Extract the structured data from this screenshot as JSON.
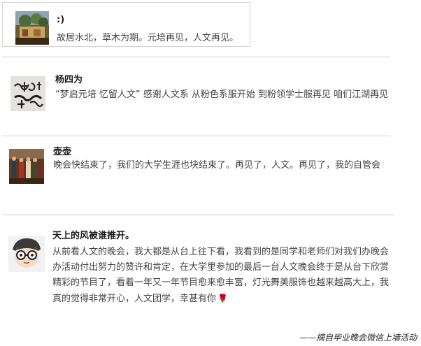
{
  "comments": [
    {
      "name": ":)",
      "text": "故居水北，草木为期。元培再见，人文再见。",
      "avatar": "landscape-avatar"
    },
    {
      "name": "杨四为",
      "text": "“梦启元培 忆留人文” 感谢人文系 从粉色系服开始 到粉领学士服再见 咱们江湖再见",
      "avatar": "calligraphy-avatar"
    },
    {
      "name": "壶壶",
      "text": "晚会快结束了，我们的大学生涯也块结束了。再见了，人文。再见了，我的自管会",
      "avatar": "painting-avatar"
    },
    {
      "name": "天上的风被谁推开。",
      "text": "从前看人文的晚会，我大都是从台上往下看，我看到的是同学和老师们对我们办晚会办活动付出努力的赞许和肯定，在大学里参加的最后一台人文晚会终于是从台下欣赏精彩的节目了，看着一年又一年节目愈来愈丰富，灯光舞美服饰也越来越高大上，我真的觉得非常开心，人文团学，幸甚有你",
      "avatar": "cartoon-glasses-avatar",
      "emoji": "rose-icon"
    }
  ],
  "caption": "——摘自毕业晚会微信上墙活动",
  "colors": {
    "name": "#1a1a1a",
    "text": "#444444",
    "divider": "#cfcfcf"
  }
}
